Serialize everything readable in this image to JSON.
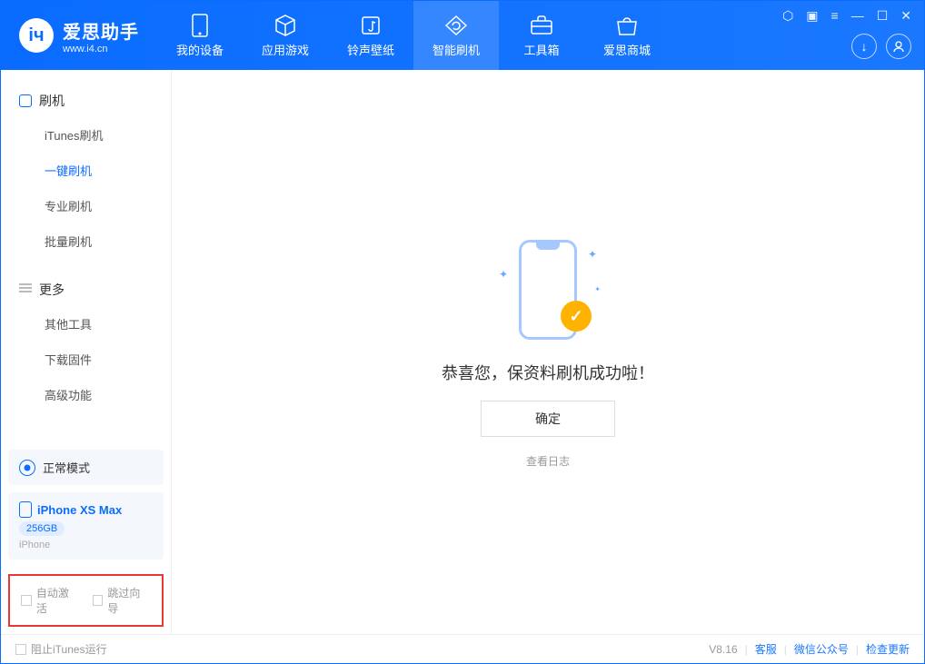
{
  "app": {
    "title": "爱思助手",
    "subtitle": "www.i4.cn"
  },
  "nav": [
    {
      "label": "我的设备",
      "icon": "device"
    },
    {
      "label": "应用游戏",
      "icon": "cube"
    },
    {
      "label": "铃声壁纸",
      "icon": "music"
    },
    {
      "label": "智能刷机",
      "icon": "refresh",
      "active": true
    },
    {
      "label": "工具箱",
      "icon": "toolbox"
    },
    {
      "label": "爱思商城",
      "icon": "shop"
    }
  ],
  "sidebar": {
    "section1": {
      "title": "刷机",
      "items": [
        "iTunes刷机",
        "一键刷机",
        "专业刷机",
        "批量刷机"
      ],
      "activeIndex": 1
    },
    "section2": {
      "title": "更多",
      "items": [
        "其他工具",
        "下载固件",
        "高级功能"
      ]
    }
  },
  "mode": {
    "label": "正常模式"
  },
  "device": {
    "name": "iPhone XS Max",
    "capacity": "256GB",
    "type": "iPhone"
  },
  "options": {
    "autoActivate": "自动激活",
    "skipGuide": "跳过向导"
  },
  "main": {
    "message": "恭喜您，保资料刷机成功啦！",
    "confirm": "确定",
    "viewLog": "查看日志"
  },
  "footer": {
    "blockItunes": "阻止iTunes运行",
    "version": "V8.16",
    "service": "客服",
    "wechat": "微信公众号",
    "update": "检查更新"
  }
}
